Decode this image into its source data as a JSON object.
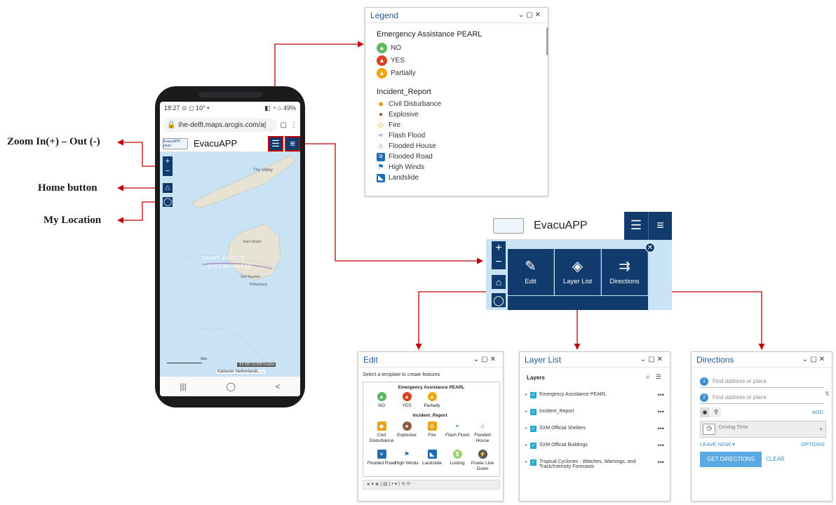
{
  "annotations": {
    "zoom": "Zoom In(+) – Out (-)",
    "home": "Home button",
    "location": "My Location"
  },
  "phone": {
    "status_time": "18:27",
    "status_icons": "⊙ ◻ 10° •",
    "status_right": "◧ ◔ ⌂ 49%",
    "url": "ihe-delft.maps.arcgis.com/a|",
    "app_title": "EvacuAPP",
    "logo_text": "EvacuAPP pearl",
    "map_labels": {
      "the_valley": "The Valley",
      "saint_martin_fr": "Saint Martin",
      "saint_martin_big": "SAINT MARTIN",
      "sint_maarten_big": "SINT MAARTEN",
      "sint_maarten_nl": "Sint Maarten",
      "philipsburg": "Philipsburg",
      "scale": "6km",
      "coords": "-63.369 18.059 Grados",
      "attribution": "Kadaster Netherlands, ..."
    },
    "nav_buttons": [
      "|||",
      "◯",
      "<"
    ]
  },
  "legend": {
    "title": "Legend",
    "section1": "Emergency Assistance PEARL",
    "pearl_items": [
      {
        "label": "NO",
        "color": "#5cb85c"
      },
      {
        "label": "YES",
        "color": "#d9411e"
      },
      {
        "label": "Partially",
        "color": "#f0a30a"
      }
    ],
    "section2": "Incident_Report",
    "incident_items": [
      {
        "label": "Civil Disturbance",
        "icon": "diamond-icon",
        "color": "#e8a317"
      },
      {
        "label": "Explosive",
        "icon": "explosive-icon",
        "color": "#8c5a3c"
      },
      {
        "label": "Fire",
        "icon": "fire-diamond-icon",
        "color": "#e8a317"
      },
      {
        "label": "Flash Flood",
        "icon": "flash-flood-icon",
        "color": "#1e6bb8"
      },
      {
        "label": "Flooded House",
        "icon": "flooded-house-icon",
        "color": "#1e6bb8"
      },
      {
        "label": "Flooded Road",
        "icon": "flooded-road-icon",
        "color": "#1e6bb8"
      },
      {
        "label": "High Winds",
        "icon": "flag-icon",
        "color": "#1e6bb8"
      },
      {
        "label": "Landslide",
        "icon": "landslide-icon",
        "color": "#1e6bb8"
      }
    ]
  },
  "menu": {
    "app_title": "EvacuAPP",
    "tiles": [
      {
        "label": "Edit",
        "icon": "edit-icon"
      },
      {
        "label": "Layer List",
        "icon": "layers-icon"
      },
      {
        "label": "Directions",
        "icon": "directions-icon"
      }
    ]
  },
  "edit": {
    "title": "Edit",
    "prompt": "Select a template to create features",
    "section1": "Emergency Assistance PEARL",
    "pearl_items": [
      "NO",
      "YES",
      "Partially"
    ],
    "section2": "Incident_Report",
    "incident_items": [
      "Civil Disturbance",
      "Explosive",
      "Fire",
      "Flash Flood",
      "Flooded House",
      "Flooded Road",
      "High Winds",
      "Landslide",
      "Looting",
      "Power Line Down"
    ]
  },
  "layer_list": {
    "title": "Layer List",
    "heading": "Layers",
    "layers": [
      "Emergency Assistance PEARL",
      "Incident_Report",
      "SXM Official Shelters",
      "SXM Official Buildings",
      "Tropical Cyclones - Watches, Warnings, and Track/Intensity Forecasts"
    ]
  },
  "directions": {
    "title": "Directions",
    "placeholder1": "Find address or place",
    "placeholder2": "Find address or place",
    "add": "ADD",
    "mode": "Driving Time",
    "leave_now": "LEAVE NOW ▾",
    "options": "OPTIONS",
    "get_directions": "GET DIRECTIONS",
    "clear": "CLEAR"
  }
}
